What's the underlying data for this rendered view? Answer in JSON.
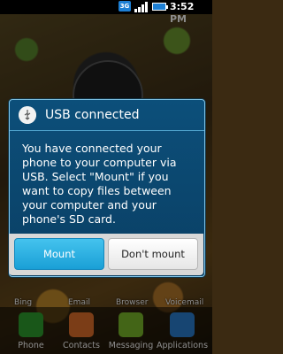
{
  "status_bar": {
    "network": "3G",
    "time": "3:52 PM"
  },
  "home_shortcuts": [
    "Bing",
    "Email",
    "Browser",
    "Voicemail"
  ],
  "dock": [
    {
      "label": "Phone",
      "icon": "phone-icon",
      "color": "#2f9e2f"
    },
    {
      "label": "Contacts",
      "icon": "contacts-icon",
      "color": "#e0702a"
    },
    {
      "label": "Messaging",
      "icon": "messaging-icon",
      "color": "#7ab82a"
    },
    {
      "label": "Applications",
      "icon": "applications-icon",
      "color": "#2a7fd0"
    }
  ],
  "dialog": {
    "title": "USB connected",
    "icon": "usb-icon",
    "message": "You have connected your phone to your computer via USB. Select \"Mount\" if you want to copy files between your computer and your phone's SD card.",
    "mount_label": "Mount",
    "dont_mount_label": "Don't mount"
  },
  "colors": {
    "dialog_bg": "#0c4f7a",
    "mount_button": "#1a9fd6",
    "status_bar": "#000000"
  }
}
